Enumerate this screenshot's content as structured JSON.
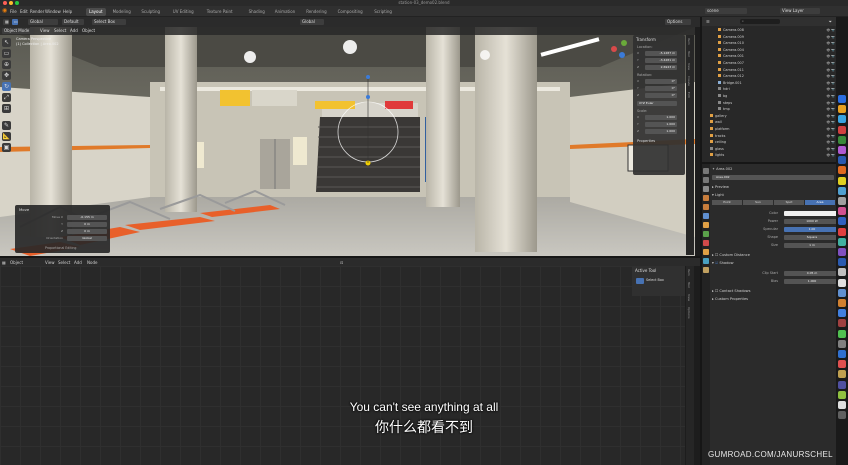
{
  "window": {
    "title": "station-03_demo02.blend",
    "menu": [
      "File",
      "Edit",
      "Render",
      "Window",
      "Help"
    ],
    "workspaces": [
      "Layout",
      "Modeling",
      "Sculpting",
      "UV Editing",
      "Texture Paint",
      "Shading",
      "Animation",
      "Rendering",
      "Compositing",
      "Scripting"
    ],
    "active_workspace": "Layout",
    "scene": "scene",
    "view_layer": "View Layer"
  },
  "viewport_header": {
    "mode": "Object Mode",
    "menus": [
      "View",
      "Select",
      "Add",
      "Object"
    ],
    "orientation": "Global",
    "pivot": "Default",
    "drag": "Select Box",
    "options": "Options",
    "camera_label": "Camera Perspective",
    "collection_label": "(1) Collection | Area.002"
  },
  "toolbar": {
    "tools": [
      {
        "icon": "cursor-icon",
        "glyph": "↖"
      },
      {
        "icon": "select-box-icon",
        "glyph": "▭"
      },
      {
        "icon": "cursor3d-icon",
        "glyph": "⊕"
      },
      {
        "icon": "move-icon",
        "glyph": "✥"
      },
      {
        "icon": "rotate-icon",
        "glyph": "↻"
      },
      {
        "icon": "scale-icon",
        "glyph": "⤢"
      },
      {
        "icon": "transform-icon",
        "glyph": "⊞"
      },
      {
        "icon": "annotate-icon",
        "glyph": "✎"
      },
      {
        "icon": "measure-icon",
        "glyph": "📐"
      },
      {
        "icon": "add-cube-icon",
        "glyph": "▣"
      }
    ]
  },
  "sidebar": {
    "section": "Transform",
    "location_label": "Location:",
    "location": [
      {
        "axis": "X",
        "value": "-5.1287 m"
      },
      {
        "axis": "Y",
        "value": "-3.4281 m"
      },
      {
        "axis": "Z",
        "value": "2.6943 m"
      }
    ],
    "rotation_label": "Rotation:",
    "rotation": [
      {
        "axis": "X",
        "value": "0°"
      },
      {
        "axis": "Y",
        "value": "0°"
      },
      {
        "axis": "Z",
        "value": "0°"
      }
    ],
    "rotation_mode": "XYZ Euler",
    "scale_label": "Scale:",
    "scale": [
      {
        "axis": "X",
        "value": "1.000"
      },
      {
        "axis": "Y",
        "value": "1.000"
      },
      {
        "axis": "Z",
        "value": "1.000"
      }
    ],
    "properties_label": "Properties",
    "tabs": [
      "Item",
      "Tool",
      "View",
      "Create",
      "Edit"
    ]
  },
  "operator_panel": {
    "title": "Move",
    "fields": [
      {
        "label": "Move X",
        "value": "-0.155 m"
      },
      {
        "label": "Y",
        "value": "0 m"
      },
      {
        "label": "Z",
        "value": "0 m"
      },
      {
        "label": "Orientation",
        "value": "Global"
      }
    ],
    "footer": "Proportional Editing"
  },
  "shader_editor": {
    "mode": "Object",
    "menus": [
      "View",
      "Select",
      "Add",
      "Node"
    ],
    "active_tool_title": "Active Tool",
    "active_tool_label": "Select Box",
    "side_tabs": [
      "Item",
      "Tool",
      "View",
      "Options"
    ]
  },
  "outliner": {
    "search_placeholder": "",
    "rows": [
      {
        "name": "Camera.008",
        "color": "#e0a045"
      },
      {
        "name": "Camera.009",
        "color": "#e0a045"
      },
      {
        "name": "Camera.010",
        "color": "#e0a045"
      },
      {
        "name": "Camera.004",
        "color": "#e0a045"
      },
      {
        "name": "Camera.001",
        "color": "#e0a045"
      },
      {
        "name": "Camera.007",
        "color": "#e0a045"
      },
      {
        "name": "Camera.011",
        "color": "#e0a045"
      },
      {
        "name": "Camera.012",
        "color": "#e0a045"
      },
      {
        "name": "Bridge.001",
        "color": "#8cb0d8"
      },
      {
        "name": "hdri",
        "color": "#888888"
      },
      {
        "name": "bg",
        "color": "#888888"
      },
      {
        "name": "steps",
        "color": "#888888"
      },
      {
        "name": "tmp",
        "color": "#888888"
      },
      {
        "name": "gallery",
        "color": "#e0a045"
      },
      {
        "name": "wall",
        "color": "#e0a045"
      },
      {
        "name": "platform",
        "color": "#e0a045"
      },
      {
        "name": "tracks",
        "color": "#e0a045"
      },
      {
        "name": "ceiling",
        "color": "#e0a045"
      },
      {
        "name": "glass",
        "color": "#888888"
      },
      {
        "name": "lights",
        "color": "#e0a045"
      }
    ]
  },
  "properties": {
    "breadcrumb": "Area.002",
    "datablock": "Area.002",
    "preview_label": "Preview",
    "light_label": "Light",
    "light_types": [
      "Point",
      "Sun",
      "Spot",
      "Area"
    ],
    "active_type": "Area",
    "fields": [
      {
        "label": "Color",
        "value": ""
      },
      {
        "label": "Power",
        "value": "1000 W"
      },
      {
        "label": "Specular",
        "value": "1.00"
      },
      {
        "label": "Shape",
        "value": "Square"
      },
      {
        "label": "Size",
        "value": "1 m"
      }
    ],
    "custom_distance": "Custom Distance",
    "shadow": "Shadow",
    "shadow_fields": [
      {
        "label": "Clip Start",
        "value": "0.05 m"
      },
      {
        "label": "Bias",
        "value": "1.000"
      }
    ],
    "contact_shadows": "Contact Shadows",
    "custom_properties": "Custom Properties"
  },
  "subtitles": {
    "english": "You can't see anything at all",
    "chinese": "你什么都看不到"
  },
  "watermark": "GUMROAD.COM/JANURSCHEL",
  "colors": {
    "accent": "#4772b3",
    "panel": "#303030",
    "bg": "#1d1d1d"
  }
}
